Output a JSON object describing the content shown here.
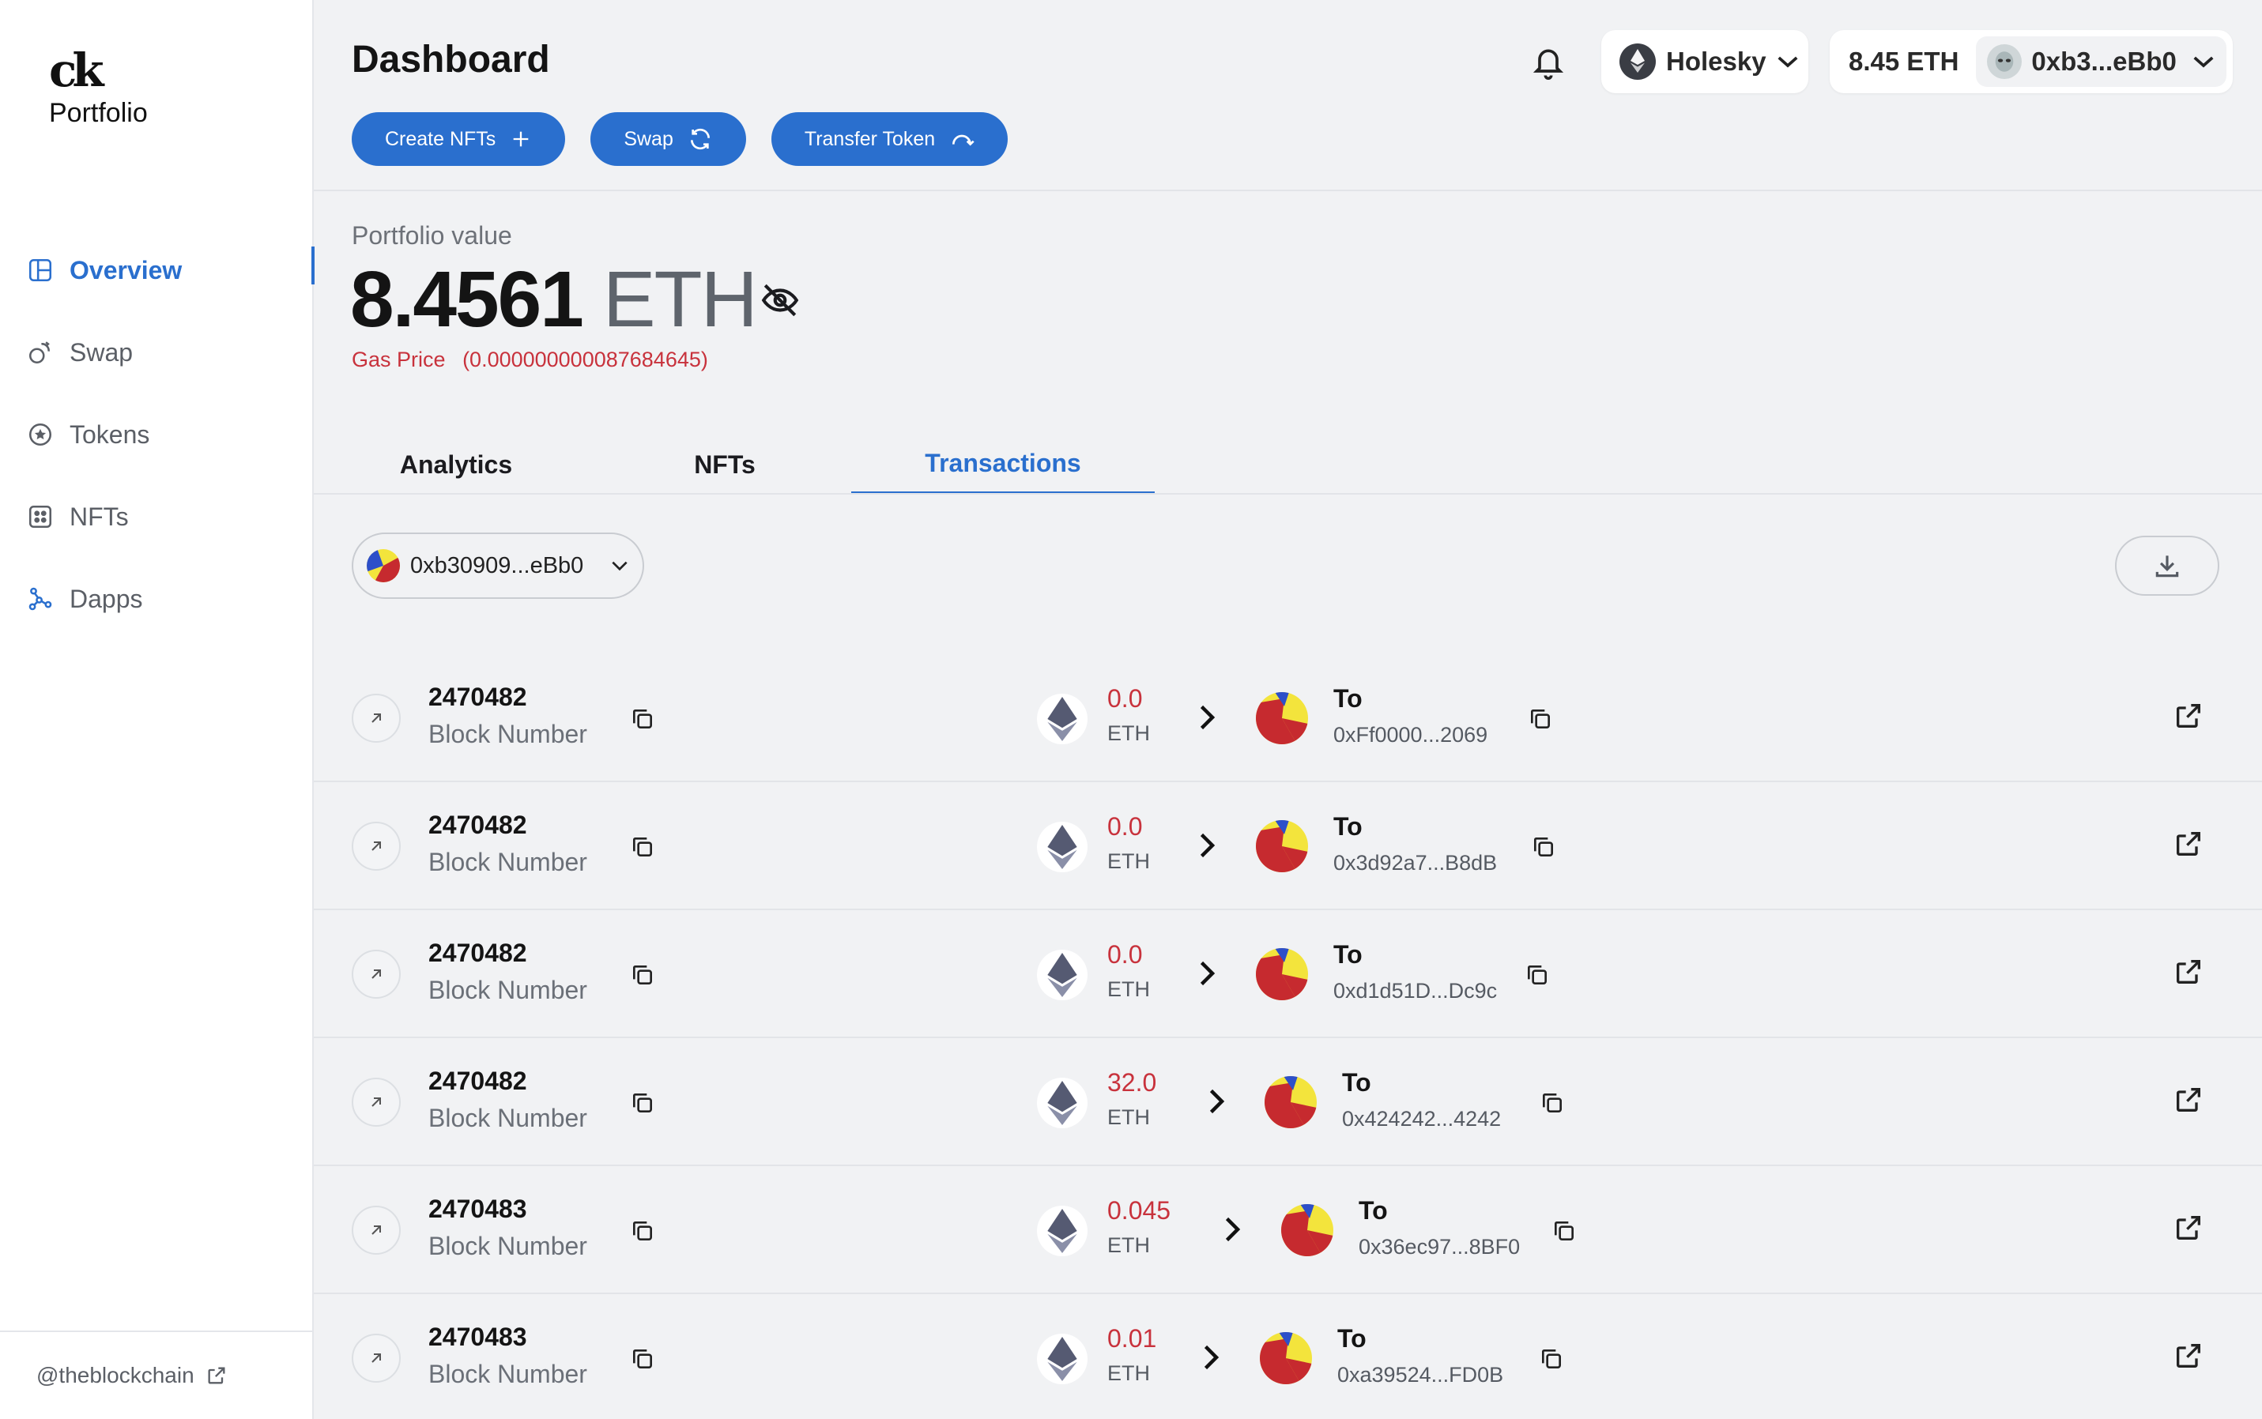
{
  "app": {
    "logo_mark": "ck",
    "logo_text": "Portfolio"
  },
  "sidebar": {
    "items": [
      {
        "label": "Overview",
        "icon": "layout-icon",
        "active": true
      },
      {
        "label": "Swap",
        "icon": "coins-swap-icon",
        "active": false
      },
      {
        "label": "Tokens",
        "icon": "token-icon",
        "active": false
      },
      {
        "label": "NFTs",
        "icon": "grid-dots-icon",
        "active": false
      },
      {
        "label": "Dapps",
        "icon": "network-icon",
        "active": false
      }
    ],
    "footer_link": "@theblockchain"
  },
  "header": {
    "title": "Dashboard",
    "actions": [
      {
        "label": "Create NFTs",
        "icon": "plus-icon"
      },
      {
        "label": "Swap",
        "icon": "refresh-icon"
      },
      {
        "label": "Transfer Token",
        "icon": "arc-arrows-icon"
      }
    ],
    "network": "Holesky",
    "balance": "8.45 ETH",
    "account": "0xb3...eBb0"
  },
  "portfolio": {
    "label": "Portfolio value",
    "value": "8.4561",
    "unit": "ETH",
    "gas_label": "Gas Price",
    "gas_value": "(0.000000000087684645)"
  },
  "tabs": [
    {
      "label": "Analytics",
      "active": false
    },
    {
      "label": "NFTs",
      "active": false
    },
    {
      "label": "Transactions",
      "active": true
    }
  ],
  "wallet_selector": {
    "value": "0xb30909...eBb0"
  },
  "transactions": [
    {
      "block": "2470482",
      "block_label": "Block Number",
      "amount": "0.0",
      "currency": "ETH",
      "to_label": "To",
      "to_address": "0xFf0000...2069"
    },
    {
      "block": "2470482",
      "block_label": "Block Number",
      "amount": "0.0",
      "currency": "ETH",
      "to_label": "To",
      "to_address": "0x3d92a7...B8dB"
    },
    {
      "block": "2470482",
      "block_label": "Block Number",
      "amount": "0.0",
      "currency": "ETH",
      "to_label": "To",
      "to_address": "0xd1d51D...Dc9c"
    },
    {
      "block": "2470482",
      "block_label": "Block Number",
      "amount": "32.0",
      "currency": "ETH",
      "to_label": "To",
      "to_address": "0x424242...4242"
    },
    {
      "block": "2470483",
      "block_label": "Block Number",
      "amount": "0.045",
      "currency": "ETH",
      "to_label": "To",
      "to_address": "0x36ec97...8BF0"
    },
    {
      "block": "2470483",
      "block_label": "Block Number",
      "amount": "0.01",
      "currency": "ETH",
      "to_label": "To",
      "to_address": "0xa39524...FD0B"
    }
  ],
  "colors": {
    "accent": "#2a6fce",
    "amount_red": "#c8323c",
    "blockie_red": "#c62a2f",
    "blockie_yellow": "#f3e43c",
    "blockie_blue": "#2d4fc9"
  }
}
